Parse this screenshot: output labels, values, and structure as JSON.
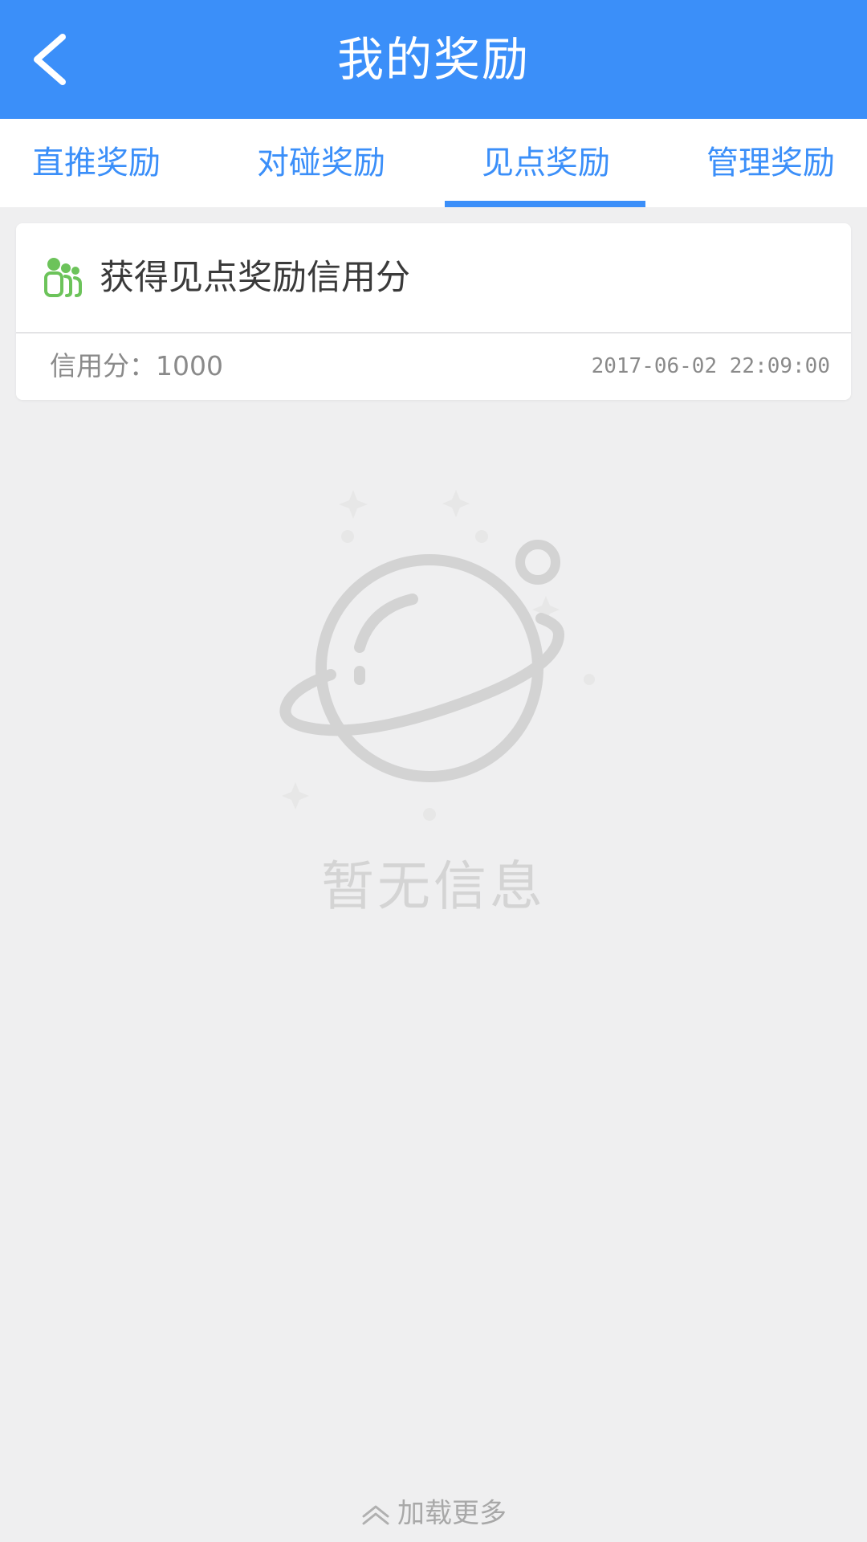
{
  "header": {
    "title": "我的奖励",
    "back_icon": "chevron-left-icon",
    "bg_color": "#3b8ff9"
  },
  "tabs": [
    {
      "label": "直推奖励",
      "active": false
    },
    {
      "label": "对碰奖励",
      "active": false
    },
    {
      "label": "见点奖励",
      "active": true
    },
    {
      "label": "管理奖励",
      "active": false
    }
  ],
  "card": {
    "icon": "people-group-icon",
    "icon_color": "#6cc35a",
    "title": "获得见点奖励信用分",
    "score": "信用分：1000",
    "time": "2017-06-02 22:09:00"
  },
  "empty": {
    "icon": "planet-icon",
    "text": "暂无信息"
  },
  "footer": {
    "load_more_icon": "chevron-up-icon",
    "load_more": "加载更多"
  }
}
